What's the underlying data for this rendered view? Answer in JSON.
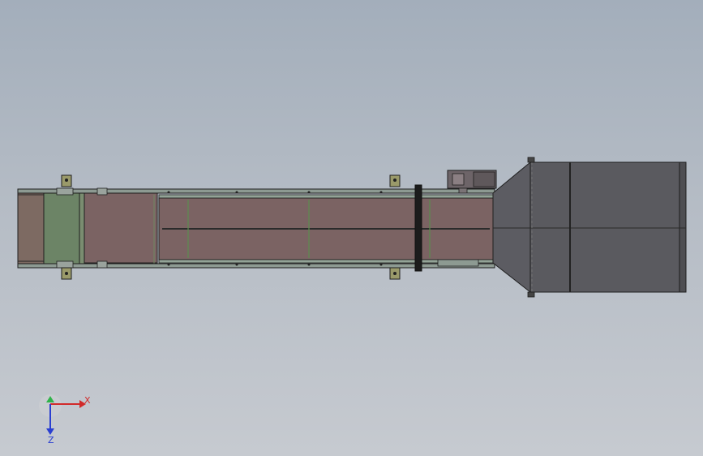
{
  "viewport": {
    "background_top": "#a3aebb",
    "background_bottom": "#c6cad0"
  },
  "model": {
    "parts": [
      "conveyor-frame",
      "conveyor-belt",
      "feed-end-roller",
      "hopper",
      "drive-motor",
      "mounting-brackets",
      "cross-band"
    ],
    "colors": {
      "belt": "#7b6363",
      "feed_end": "#6c8466",
      "frame": "#8d9a92",
      "hopper": "#5a5a5f",
      "motor": "#6d6468",
      "outline": "#1f1f1f",
      "bracket": "#9a9a6a"
    }
  },
  "triad": {
    "x_label": "X",
    "z_label": "Z",
    "x_color": "#d12a2a",
    "y_color": "#2fb34a",
    "z_color": "#2a3fd1"
  }
}
